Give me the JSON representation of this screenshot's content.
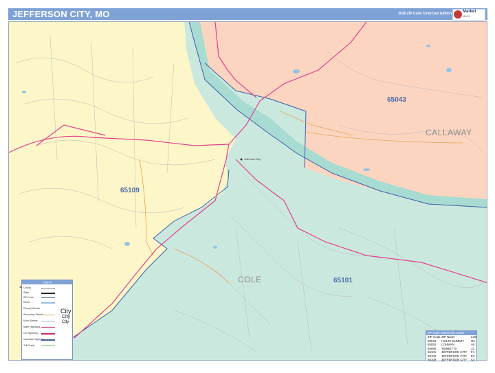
{
  "header": {
    "title": "JEFFERSON CITY, MO",
    "edition": "2026 ZIP Code ColorCast Edition",
    "logo_line1": "Market",
    "logo_line2": "MAPS"
  },
  "map": {
    "zip_labels": [
      "65043",
      "65109",
      "65101"
    ],
    "county_labels": [
      "CALLAWAY",
      "COLE"
    ],
    "city_label": "Jefferson City",
    "colors": {
      "zip_65043": "#fcd5c1",
      "zip_65109": "#fdf6c8",
      "zip_65101": "#cbe8df",
      "river": "#abdcd3",
      "highway": "#e0408a",
      "zip_line": "#3b5fa5",
      "road": "#b0b0b0"
    }
  },
  "legend": {
    "title": "Legend",
    "rows": [
      "County",
      "State",
      "ZIP Code",
      "Rivers",
      "Primary Streets",
      "Secondary Streets",
      "Minor Streets",
      "State Highways",
      "US Highways",
      "Interstate Highways",
      "Toll Roads"
    ],
    "city_samples": [
      "City",
      "City",
      "City"
    ]
  },
  "zip_index": {
    "title": "ZIP Code Index/Grid Locator",
    "columns": [
      "ZIP Code",
      "ZIP Name",
      "LOC"
    ],
    "rows": [
      [
        "65043",
        "HOLTS SUMMIT",
        "G2"
      ],
      [
        "65053",
        "LOHMAN",
        "A5"
      ],
      [
        "65080",
        "TEBBETTS",
        "J2"
      ],
      [
        "65101",
        "JEFFERSON CITY",
        "F4"
      ],
      [
        "65102",
        "JEFFERSON CITY",
        "E3"
      ],
      [
        "65109",
        "JEFFERSON CITY",
        "C4"
      ]
    ]
  }
}
